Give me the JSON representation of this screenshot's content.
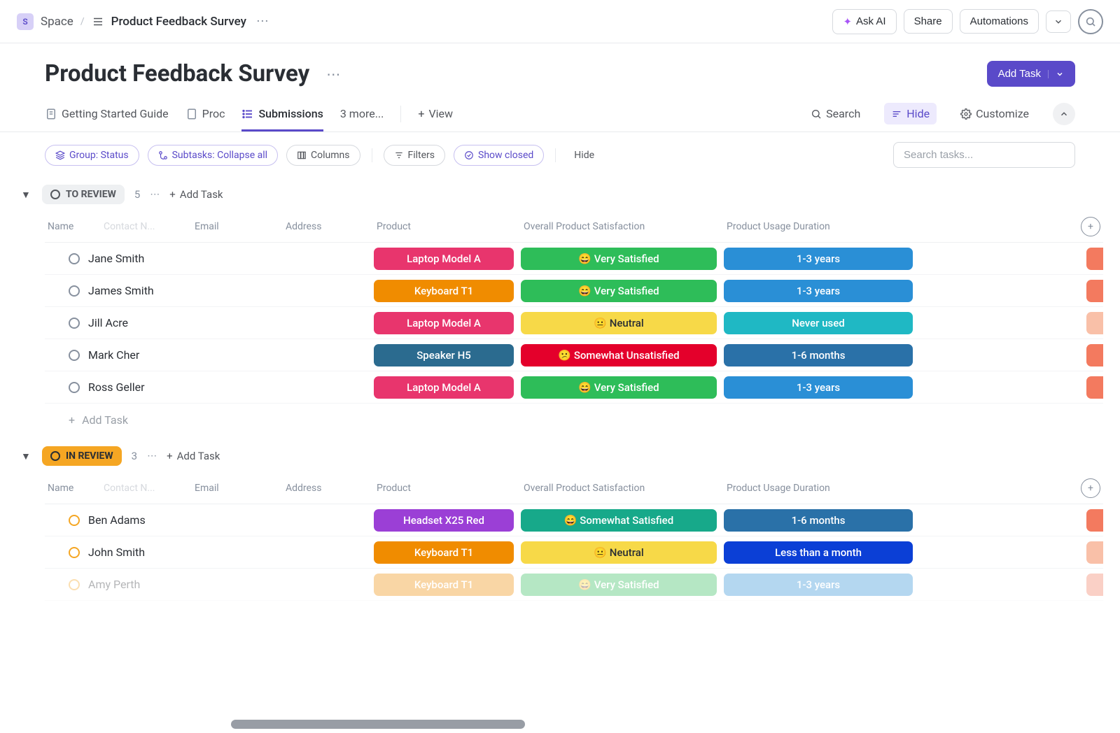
{
  "breadcrumb": {
    "space_icon": "S",
    "space": "Space",
    "title": "Product Feedback Survey"
  },
  "top": {
    "ask_ai": "Ask AI",
    "share": "Share",
    "automations": "Automations"
  },
  "header": {
    "title": "Product Feedback Survey",
    "add_task": "Add Task"
  },
  "tabs": {
    "guide": "Getting Started Guide",
    "proc": "Proc",
    "submissions": "Submissions",
    "more": "3 more...",
    "view": "View"
  },
  "toolbar": {
    "search": "Search",
    "hide": "Hide",
    "customize": "Customize"
  },
  "filters": {
    "group": "Group: Status",
    "subtasks": "Subtasks: Collapse all",
    "columns": "Columns",
    "filters": "Filters",
    "show_closed": "Show closed",
    "hide": "Hide",
    "search_placeholder": "Search tasks..."
  },
  "columns": {
    "name": "Name",
    "contact": "Contact N...",
    "email": "Email",
    "address": "Address",
    "product": "Product",
    "satisfaction": "Overall Product Satisfaction",
    "duration": "Product Usage Duration"
  },
  "groups": [
    {
      "label": "TO REVIEW",
      "count": "5",
      "add": "Add Task",
      "style": "gray",
      "row_add": "Add Task",
      "rows": [
        {
          "name": "Jane Smith",
          "product": {
            "t": "Laptop Model A",
            "c": "#e8356d"
          },
          "sat": {
            "t": "😄 Very Satisfied",
            "c": "#2ebd59"
          },
          "dur": {
            "t": "1-3 years",
            "c": "#2a8fd6"
          },
          "tail": "#f37a5f"
        },
        {
          "name": "James Smith",
          "product": {
            "t": "Keyboard T1",
            "c": "#f08c00"
          },
          "sat": {
            "t": "😄 Very Satisfied",
            "c": "#2ebd59"
          },
          "dur": {
            "t": "1-3 years",
            "c": "#2a8fd6"
          },
          "tail": "#f37a5f"
        },
        {
          "name": "Jill Acre",
          "product": {
            "t": "Laptop Model A",
            "c": "#e8356d"
          },
          "sat": {
            "t": "😐 Neutral",
            "c": "#f7d948",
            "tc": "#2a2e34"
          },
          "dur": {
            "t": "Never used",
            "c": "#1fb8c4"
          },
          "tail": "#f9c0a8"
        },
        {
          "name": "Mark Cher",
          "product": {
            "t": "Speaker H5",
            "c": "#2b6b8f"
          },
          "sat": {
            "t": "😕 Somewhat Unsatisfied",
            "c": "#e4002b"
          },
          "dur": {
            "t": "1-6 months",
            "c": "#2a71a8"
          },
          "tail": "#f37a5f"
        },
        {
          "name": "Ross Geller",
          "product": {
            "t": "Laptop Model A",
            "c": "#e8356d"
          },
          "sat": {
            "t": "😄 Very Satisfied",
            "c": "#2ebd59"
          },
          "dur": {
            "t": "1-3 years",
            "c": "#2a8fd6"
          },
          "tail": "#f37a5f"
        }
      ]
    },
    {
      "label": "IN REVIEW",
      "count": "3",
      "add": "Add Task",
      "style": "orange",
      "rows": [
        {
          "name": "Ben Adams",
          "status": "orange",
          "product": {
            "t": "Headset X25 Red",
            "c": "#9b3fd6"
          },
          "sat": {
            "t": "😄 Somewhat Satisfied",
            "c": "#17a98a"
          },
          "dur": {
            "t": "1-6 months",
            "c": "#2a71a8"
          },
          "tail": "#f37a5f"
        },
        {
          "name": "John Smith",
          "status": "orange",
          "product": {
            "t": "Keyboard T1",
            "c": "#f08c00"
          },
          "sat": {
            "t": "😐 Neutral",
            "c": "#f7d948",
            "tc": "#2a2e34"
          },
          "dur": {
            "t": "Less than a month",
            "c": "#0b3fd6"
          },
          "tail": "#f9c0a8"
        },
        {
          "name": "Amy Perth",
          "status": "orange",
          "faded": true,
          "product": {
            "t": "Keyboard T1",
            "c": "#f08c00"
          },
          "sat": {
            "t": "😄 Very Satisfied",
            "c": "#2ebd59"
          },
          "dur": {
            "t": "1-3 years",
            "c": "#2a8fd6"
          },
          "tail": "#f37a5f"
        }
      ]
    }
  ]
}
